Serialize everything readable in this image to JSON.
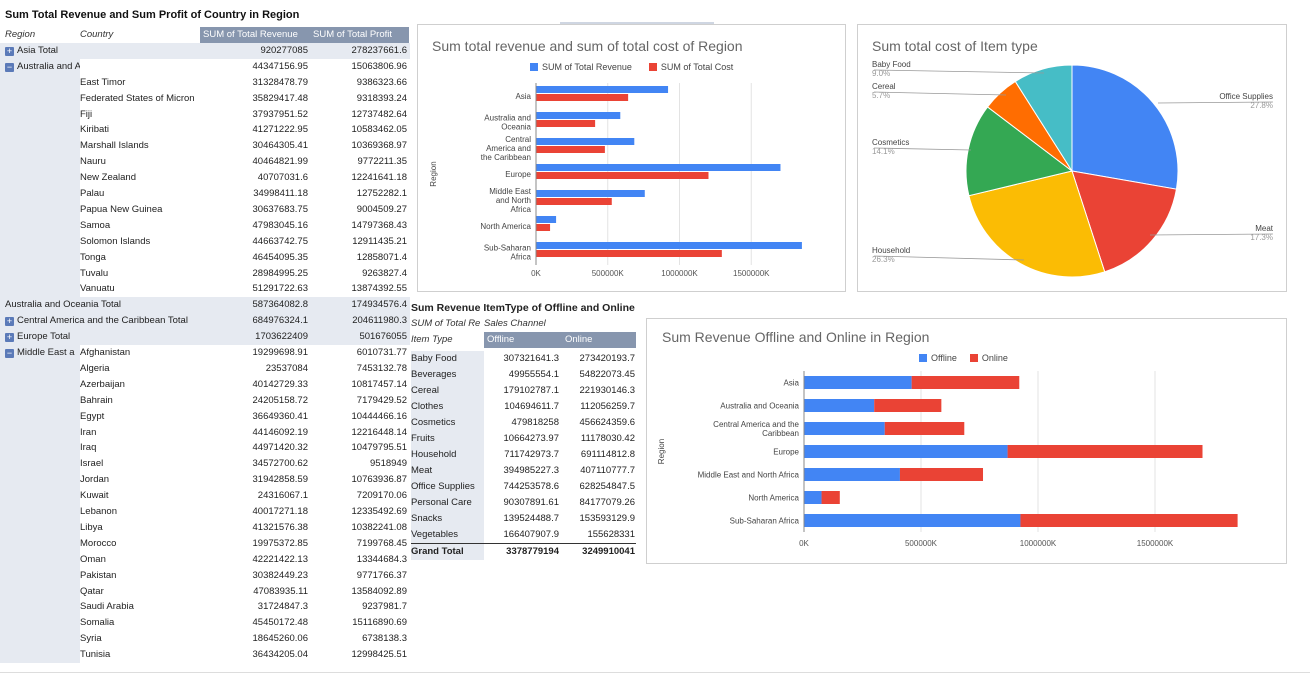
{
  "pivot1": {
    "title": "Sum Total Revenue and Sum Profit of Country in Region",
    "headers": {
      "region": "Region",
      "country": "Country",
      "revenue": "SUM of Total Revenue",
      "profit": "SUM of Total Profit"
    },
    "rows": [
      {
        "region": "Asia Total",
        "country": "",
        "revenue": "920277085",
        "profit": "278237661.6",
        "kind": "total",
        "icon": "+"
      },
      {
        "region": "Australia and Australia",
        "country": "",
        "revenue": "44347156.95",
        "profit": "15063806.96",
        "kind": "group",
        "icon": "-"
      },
      {
        "region": "",
        "country": "East Timor",
        "revenue": "31328478.79",
        "profit": "9386323.66",
        "kind": "row"
      },
      {
        "region": "",
        "country": "Federated States of Micron",
        "revenue": "35829417.48",
        "profit": "9318393.24",
        "kind": "row"
      },
      {
        "region": "",
        "country": "Fiji",
        "revenue": "37937951.52",
        "profit": "12737482.64",
        "kind": "row"
      },
      {
        "region": "",
        "country": "Kiribati",
        "revenue": "41271222.95",
        "profit": "10583462.05",
        "kind": "row"
      },
      {
        "region": "",
        "country": "Marshall Islands",
        "revenue": "30464305.41",
        "profit": "10369368.97",
        "kind": "row"
      },
      {
        "region": "",
        "country": "Nauru",
        "revenue": "40464821.99",
        "profit": "9772211.35",
        "kind": "row"
      },
      {
        "region": "",
        "country": "New Zealand",
        "revenue": "40707031.6",
        "profit": "12241641.18",
        "kind": "row"
      },
      {
        "region": "",
        "country": "Palau",
        "revenue": "34998411.18",
        "profit": "12752282.1",
        "kind": "row"
      },
      {
        "region": "",
        "country": "Papua New Guinea",
        "revenue": "30637683.75",
        "profit": "9004509.27",
        "kind": "row"
      },
      {
        "region": "",
        "country": "Samoa",
        "revenue": "47983045.16",
        "profit": "14797368.43",
        "kind": "row"
      },
      {
        "region": "",
        "country": "Solomon Islands",
        "revenue": "44663742.75",
        "profit": "12911435.21",
        "kind": "row"
      },
      {
        "region": "",
        "country": "Tonga",
        "revenue": "46454095.35",
        "profit": "12858071.4",
        "kind": "row"
      },
      {
        "region": "",
        "country": "Tuvalu",
        "revenue": "28984995.25",
        "profit": "9263827.4",
        "kind": "row"
      },
      {
        "region": "",
        "country": "Vanuatu",
        "revenue": "51291722.63",
        "profit": "13874392.55",
        "kind": "row"
      },
      {
        "region": "Australia and Oceania Total",
        "country": "",
        "revenue": "587364082.8",
        "profit": "174934576.4",
        "kind": "total"
      },
      {
        "region": "Central America and the Caribbean Total",
        "country": "",
        "revenue": "684976324.1",
        "profit": "204611980.3",
        "kind": "total",
        "icon": "+"
      },
      {
        "region": "Europe Total",
        "country": "",
        "revenue": "1703622409",
        "profit": "501676055",
        "kind": "total",
        "icon": "+"
      },
      {
        "region": "Middle East a",
        "country": "Afghanistan",
        "revenue": "19299698.91",
        "profit": "6010731.77",
        "kind": "group",
        "icon": "-"
      },
      {
        "region": "",
        "country": "Algeria",
        "revenue": "23537084",
        "profit": "7453132.78",
        "kind": "row"
      },
      {
        "region": "",
        "country": "Azerbaijan",
        "revenue": "40142729.33",
        "profit": "10817457.14",
        "kind": "row"
      },
      {
        "region": "",
        "country": "Bahrain",
        "revenue": "24205158.72",
        "profit": "7179429.52",
        "kind": "row"
      },
      {
        "region": "",
        "country": "Egypt",
        "revenue": "36649360.41",
        "profit": "10444466.16",
        "kind": "row"
      },
      {
        "region": "",
        "country": "Iran",
        "revenue": "44146092.19",
        "profit": "12216448.14",
        "kind": "row"
      },
      {
        "region": "",
        "country": "Iraq",
        "revenue": "44971420.32",
        "profit": "10479795.51",
        "kind": "row"
      },
      {
        "region": "",
        "country": "Israel",
        "revenue": "34572700.62",
        "profit": "9518949",
        "kind": "row"
      },
      {
        "region": "",
        "country": "Jordan",
        "revenue": "31942858.59",
        "profit": "10763936.87",
        "kind": "row"
      },
      {
        "region": "",
        "country": "Kuwait",
        "revenue": "24316067.1",
        "profit": "7209170.06",
        "kind": "row"
      },
      {
        "region": "",
        "country": "Lebanon",
        "revenue": "40017271.18",
        "profit": "12335492.69",
        "kind": "row"
      },
      {
        "region": "",
        "country": "Libya",
        "revenue": "41321576.38",
        "profit": "10382241.08",
        "kind": "row"
      },
      {
        "region": "",
        "country": "Morocco",
        "revenue": "19975372.85",
        "profit": "7199768.45",
        "kind": "row"
      },
      {
        "region": "",
        "country": "Oman",
        "revenue": "42221422.13",
        "profit": "13344684.3",
        "kind": "row"
      },
      {
        "region": "",
        "country": "Pakistan",
        "revenue": "30382449.23",
        "profit": "9771766.37",
        "kind": "row"
      },
      {
        "region": "",
        "country": "Qatar",
        "revenue": "47083935.11",
        "profit": "13584092.89",
        "kind": "row"
      },
      {
        "region": "",
        "country": "Saudi Arabia",
        "revenue": "31724847.3",
        "profit": "9237981.7",
        "kind": "row"
      },
      {
        "region": "",
        "country": "Somalia",
        "revenue": "45450172.48",
        "profit": "15116890.69",
        "kind": "row"
      },
      {
        "region": "",
        "country": "Syria",
        "revenue": "18645260.06",
        "profit": "6738138.3",
        "kind": "row"
      },
      {
        "region": "",
        "country": "Tunisia",
        "revenue": "36434205.04",
        "profit": "12998425.51",
        "kind": "row"
      }
    ]
  },
  "pivot2": {
    "title": "Sum Revenue ItemType of Offline and Online",
    "corner": "SUM of Total Re",
    "channel_label": "Sales Channel",
    "col_item": "Item Type",
    "col_offline": "Offline",
    "col_online": "Online",
    "rows": [
      {
        "item": "Baby Food",
        "offline": "307321641.3",
        "online": "273420193.7"
      },
      {
        "item": "Beverages",
        "offline": "49955554.1",
        "online": "54822073.45"
      },
      {
        "item": "Cereal",
        "offline": "179102787.1",
        "online": "221930146.3"
      },
      {
        "item": "Clothes",
        "offline": "104694611.7",
        "online": "112056259.7"
      },
      {
        "item": "Cosmetics",
        "offline": "479818258",
        "online": "456624359.6"
      },
      {
        "item": "Fruits",
        "offline": "10664273.97",
        "online": "11178030.42"
      },
      {
        "item": "Household",
        "offline": "711742973.7",
        "online": "691114812.8"
      },
      {
        "item": "Meat",
        "offline": "394985227.3",
        "online": "407110777.7"
      },
      {
        "item": "Office Supplies",
        "offline": "744253578.6",
        "online": "628254847.5"
      },
      {
        "item": "Personal Care",
        "offline": "90307891.61",
        "online": "84177079.26"
      },
      {
        "item": "Snacks",
        "offline": "139524488.7",
        "online": "153593129.9"
      },
      {
        "item": "Vegetables",
        "offline": "166407907.9",
        "online": "155628331"
      }
    ],
    "grand": {
      "item": "Grand Total",
      "offline": "3378779194",
      "online": "3249910041"
    }
  },
  "chart_data": [
    {
      "type": "bar",
      "orientation": "horizontal",
      "title": "Sum total revenue and sum of total cost of Region",
      "ylabel": "Region",
      "categories": [
        "Asia",
        "Australia and Oceania",
        "Central America and the Caribbean",
        "Europe",
        "Middle East and North Africa",
        "North America",
        "Sub-Saharan Africa"
      ],
      "series": [
        {
          "name": "SUM of Total Revenue",
          "color": "#4285f4",
          "values": [
            920277085,
            587364082.8,
            684976324.1,
            1703622409,
            758000000,
            140000000,
            1853000000
          ]
        },
        {
          "name": "SUM of Total Cost",
          "color": "#ea4335",
          "values": [
            642000000,
            412000000,
            480000000,
            1202000000,
            528000000,
            98000000,
            1295000000
          ]
        }
      ],
      "xticks": [
        "0K",
        "500000K",
        "1000000K",
        "1500000K"
      ],
      "xlim": [
        0,
        2000000000
      ],
      "legend": "top"
    },
    {
      "type": "pie",
      "title": "Sum total cost of Item type",
      "slices": [
        {
          "label": "Office Supplies",
          "percent": "27.8%",
          "value": 27.8,
          "color": "#4285f4"
        },
        {
          "label": "Meat",
          "percent": "17.3%",
          "value": 17.3,
          "color": "#ea4335"
        },
        {
          "label": "Household",
          "percent": "26.3%",
          "value": 26.3,
          "color": "#fbbc04"
        },
        {
          "label": "Cosmetics",
          "percent": "14.1%",
          "value": 14.1,
          "color": "#34a853"
        },
        {
          "label": "Cereal",
          "percent": "5.7%",
          "value": 5.7,
          "color": "#ff6d01"
        },
        {
          "label": "Baby Food",
          "percent": "9.0%",
          "value": 9.0,
          "color": "#46bdc6"
        }
      ]
    },
    {
      "type": "bar",
      "orientation": "horizontal",
      "stacked": true,
      "title": "Sum Revenue Offline and Online in Region",
      "ylabel": "Region",
      "categories": [
        "Asia",
        "Australia and Oceania",
        "Central America and the Caribbean",
        "Europe",
        "Middle East and North Africa",
        "North America",
        "Sub-Saharan Africa"
      ],
      "series": [
        {
          "name": "Offline",
          "color": "#4285f4",
          "values": [
            460000000,
            300000000,
            345000000,
            870000000,
            410000000,
            75000000,
            925000000
          ]
        },
        {
          "name": "Online",
          "color": "#ea4335",
          "values": [
            460000000,
            287000000,
            340000000,
            833000000,
            355000000,
            78000000,
            928000000
          ]
        }
      ],
      "xticks": [
        "0K",
        "500000K",
        "1000000K",
        "1500000K"
      ],
      "xlim": [
        0,
        2000000000
      ],
      "legend": "top"
    }
  ]
}
